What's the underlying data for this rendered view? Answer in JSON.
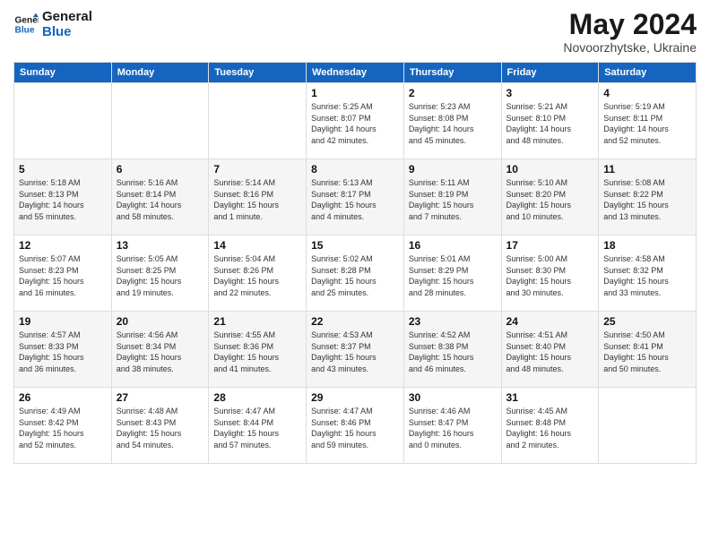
{
  "header": {
    "logo_line1": "General",
    "logo_line2": "Blue",
    "month": "May 2024",
    "location": "Novoorzhytske, Ukraine"
  },
  "days_of_week": [
    "Sunday",
    "Monday",
    "Tuesday",
    "Wednesday",
    "Thursday",
    "Friday",
    "Saturday"
  ],
  "weeks": [
    [
      {
        "day": "",
        "info": ""
      },
      {
        "day": "",
        "info": ""
      },
      {
        "day": "",
        "info": ""
      },
      {
        "day": "1",
        "info": "Sunrise: 5:25 AM\nSunset: 8:07 PM\nDaylight: 14 hours\nand 42 minutes."
      },
      {
        "day": "2",
        "info": "Sunrise: 5:23 AM\nSunset: 8:08 PM\nDaylight: 14 hours\nand 45 minutes."
      },
      {
        "day": "3",
        "info": "Sunrise: 5:21 AM\nSunset: 8:10 PM\nDaylight: 14 hours\nand 48 minutes."
      },
      {
        "day": "4",
        "info": "Sunrise: 5:19 AM\nSunset: 8:11 PM\nDaylight: 14 hours\nand 52 minutes."
      }
    ],
    [
      {
        "day": "5",
        "info": "Sunrise: 5:18 AM\nSunset: 8:13 PM\nDaylight: 14 hours\nand 55 minutes."
      },
      {
        "day": "6",
        "info": "Sunrise: 5:16 AM\nSunset: 8:14 PM\nDaylight: 14 hours\nand 58 minutes."
      },
      {
        "day": "7",
        "info": "Sunrise: 5:14 AM\nSunset: 8:16 PM\nDaylight: 15 hours\nand 1 minute."
      },
      {
        "day": "8",
        "info": "Sunrise: 5:13 AM\nSunset: 8:17 PM\nDaylight: 15 hours\nand 4 minutes."
      },
      {
        "day": "9",
        "info": "Sunrise: 5:11 AM\nSunset: 8:19 PM\nDaylight: 15 hours\nand 7 minutes."
      },
      {
        "day": "10",
        "info": "Sunrise: 5:10 AM\nSunset: 8:20 PM\nDaylight: 15 hours\nand 10 minutes."
      },
      {
        "day": "11",
        "info": "Sunrise: 5:08 AM\nSunset: 8:22 PM\nDaylight: 15 hours\nand 13 minutes."
      }
    ],
    [
      {
        "day": "12",
        "info": "Sunrise: 5:07 AM\nSunset: 8:23 PM\nDaylight: 15 hours\nand 16 minutes."
      },
      {
        "day": "13",
        "info": "Sunrise: 5:05 AM\nSunset: 8:25 PM\nDaylight: 15 hours\nand 19 minutes."
      },
      {
        "day": "14",
        "info": "Sunrise: 5:04 AM\nSunset: 8:26 PM\nDaylight: 15 hours\nand 22 minutes."
      },
      {
        "day": "15",
        "info": "Sunrise: 5:02 AM\nSunset: 8:28 PM\nDaylight: 15 hours\nand 25 minutes."
      },
      {
        "day": "16",
        "info": "Sunrise: 5:01 AM\nSunset: 8:29 PM\nDaylight: 15 hours\nand 28 minutes."
      },
      {
        "day": "17",
        "info": "Sunrise: 5:00 AM\nSunset: 8:30 PM\nDaylight: 15 hours\nand 30 minutes."
      },
      {
        "day": "18",
        "info": "Sunrise: 4:58 AM\nSunset: 8:32 PM\nDaylight: 15 hours\nand 33 minutes."
      }
    ],
    [
      {
        "day": "19",
        "info": "Sunrise: 4:57 AM\nSunset: 8:33 PM\nDaylight: 15 hours\nand 36 minutes."
      },
      {
        "day": "20",
        "info": "Sunrise: 4:56 AM\nSunset: 8:34 PM\nDaylight: 15 hours\nand 38 minutes."
      },
      {
        "day": "21",
        "info": "Sunrise: 4:55 AM\nSunset: 8:36 PM\nDaylight: 15 hours\nand 41 minutes."
      },
      {
        "day": "22",
        "info": "Sunrise: 4:53 AM\nSunset: 8:37 PM\nDaylight: 15 hours\nand 43 minutes."
      },
      {
        "day": "23",
        "info": "Sunrise: 4:52 AM\nSunset: 8:38 PM\nDaylight: 15 hours\nand 46 minutes."
      },
      {
        "day": "24",
        "info": "Sunrise: 4:51 AM\nSunset: 8:40 PM\nDaylight: 15 hours\nand 48 minutes."
      },
      {
        "day": "25",
        "info": "Sunrise: 4:50 AM\nSunset: 8:41 PM\nDaylight: 15 hours\nand 50 minutes."
      }
    ],
    [
      {
        "day": "26",
        "info": "Sunrise: 4:49 AM\nSunset: 8:42 PM\nDaylight: 15 hours\nand 52 minutes."
      },
      {
        "day": "27",
        "info": "Sunrise: 4:48 AM\nSunset: 8:43 PM\nDaylight: 15 hours\nand 54 minutes."
      },
      {
        "day": "28",
        "info": "Sunrise: 4:47 AM\nSunset: 8:44 PM\nDaylight: 15 hours\nand 57 minutes."
      },
      {
        "day": "29",
        "info": "Sunrise: 4:47 AM\nSunset: 8:46 PM\nDaylight: 15 hours\nand 59 minutes."
      },
      {
        "day": "30",
        "info": "Sunrise: 4:46 AM\nSunset: 8:47 PM\nDaylight: 16 hours\nand 0 minutes."
      },
      {
        "day": "31",
        "info": "Sunrise: 4:45 AM\nSunset: 8:48 PM\nDaylight: 16 hours\nand 2 minutes."
      },
      {
        "day": "",
        "info": ""
      }
    ]
  ]
}
